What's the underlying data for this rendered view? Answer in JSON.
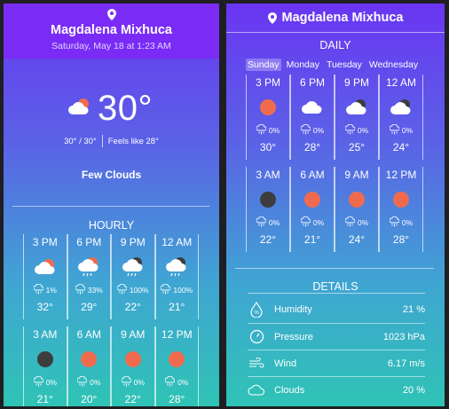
{
  "left": {
    "location": "Magdalena Mixhuca",
    "date": "Saturday, May 18 at 1:23 AM",
    "temperature": "30°",
    "minmax": "30° / 30°",
    "feels_like": "Feels like 28°",
    "description": "Few Clouds",
    "hourly_title": "HOURLY",
    "hourly": [
      {
        "time": "3 PM",
        "icon": "few-clouds-day-icon",
        "precip": "1%",
        "temp": "32°"
      },
      {
        "time": "6 PM",
        "icon": "rain-day-icon",
        "precip": "33%",
        "temp": "29°"
      },
      {
        "time": "9 PM",
        "icon": "rain-night-icon",
        "precip": "100%",
        "temp": "22°"
      },
      {
        "time": "12 AM",
        "icon": "rain-night-icon",
        "precip": "100%",
        "temp": "21°"
      },
      {
        "time": "3 AM",
        "icon": "moon-icon",
        "precip": "0%",
        "temp": "21°"
      },
      {
        "time": "6 AM",
        "icon": "sun-icon",
        "precip": "0%",
        "temp": "20°"
      },
      {
        "time": "9 AM",
        "icon": "sun-icon",
        "precip": "0%",
        "temp": "22°"
      },
      {
        "time": "12 PM",
        "icon": "sun-icon",
        "precip": "0%",
        "temp": "28°"
      }
    ]
  },
  "right": {
    "location": "Magdalena Mixhuca",
    "daily_title": "DAILY",
    "days": [
      "Sunday",
      "Monday",
      "Tuesday",
      "Wednesday"
    ],
    "selected_day": "Sunday",
    "daily": [
      {
        "time": "3 PM",
        "icon": "sun-icon",
        "precip": "0%",
        "temp": "30°"
      },
      {
        "time": "6 PM",
        "icon": "cloud-icon",
        "precip": "0%",
        "temp": "28°"
      },
      {
        "time": "9 PM",
        "icon": "cloud-night-icon",
        "precip": "0%",
        "temp": "25°"
      },
      {
        "time": "12 AM",
        "icon": "cloud-night-icon",
        "precip": "0%",
        "temp": "24°"
      },
      {
        "time": "3 AM",
        "icon": "moon-icon",
        "precip": "0%",
        "temp": "22°"
      },
      {
        "time": "6 AM",
        "icon": "sun-icon",
        "precip": "0%",
        "temp": "21°"
      },
      {
        "time": "9 AM",
        "icon": "sun-icon",
        "precip": "0%",
        "temp": "24°"
      },
      {
        "time": "12 PM",
        "icon": "sun-icon",
        "precip": "0%",
        "temp": "28°"
      }
    ],
    "details_title": "DETAILS",
    "details": [
      {
        "label": "Humidity",
        "value": "21 %",
        "icon": "humidity-icon"
      },
      {
        "label": "Pressure",
        "value": "1023 hPa",
        "icon": "pressure-icon"
      },
      {
        "label": "Wind",
        "value": "6.17 m/s",
        "icon": "wind-icon"
      },
      {
        "label": "Clouds",
        "value": "20 %",
        "icon": "clouds-icon"
      }
    ]
  },
  "colors": {
    "sun": "#f06b4e",
    "moon": "#3d3d3d",
    "header": "#7a2cf6"
  }
}
